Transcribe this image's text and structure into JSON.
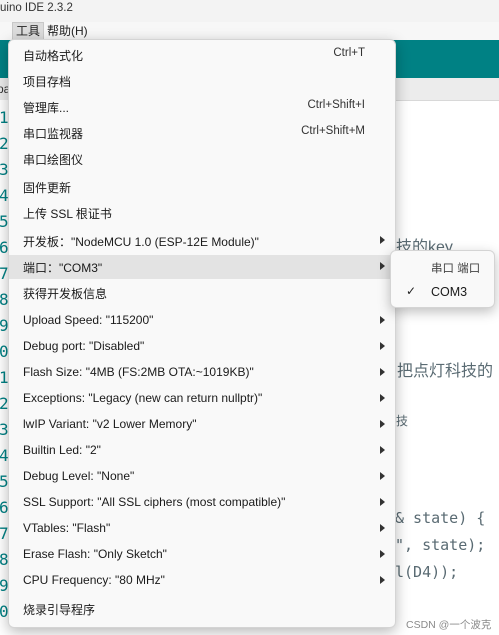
{
  "window": {
    "title": "uino IDE 2.3.2"
  },
  "menubar": {
    "file_fragment": "l",
    "tools": "工具",
    "help": "帮助(H)"
  },
  "editor": {
    "tab_fragment": "pa",
    "line_numbers": [
      "1",
      "2",
      "3",
      "4",
      "5",
      "6",
      "7",
      "8",
      "9",
      "0",
      "1",
      "2",
      "3",
      "4",
      "5",
      "6",
      "7",
      "8",
      "9",
      "0"
    ],
    "code": {
      "key_fragment": "技的key",
      "light_fragment": "把点灯科技的",
      "small_fragment": "技",
      "state_line": "& state) {",
      "state_print": "\", state);",
      "d4_line": "l(D4));"
    }
  },
  "tools_menu": {
    "items": [
      {
        "label": "自动格式化",
        "shortcut": "Ctrl+T"
      },
      {
        "label": "项目存档"
      },
      {
        "label": "管理库...",
        "shortcut": "Ctrl+Shift+I"
      },
      {
        "label": "串口监视器",
        "shortcut": "Ctrl+Shift+M"
      },
      {
        "label": "串口绘图仪"
      },
      {
        "label": "固件更新"
      },
      {
        "label": "上传 SSL 根证书"
      },
      {
        "label": "开发板：\"NodeMCU 1.0 (ESP-12E Module)\"",
        "submenu": true
      },
      {
        "label": "端口：\"COM3\"",
        "submenu": true,
        "highlighted": true
      },
      {
        "label": "获得开发板信息"
      },
      {
        "label": "Upload Speed: \"115200\"",
        "submenu": true
      },
      {
        "label": "Debug port: \"Disabled\"",
        "submenu": true
      },
      {
        "label": "Flash Size: \"4MB (FS:2MB OTA:~1019KB)\"",
        "submenu": true
      },
      {
        "label": "Exceptions: \"Legacy (new can return nullptr)\"",
        "submenu": true
      },
      {
        "label": "lwIP Variant: \"v2 Lower Memory\"",
        "submenu": true
      },
      {
        "label": "Builtin Led: \"2\"",
        "submenu": true
      },
      {
        "label": "Debug Level: \"None\"",
        "submenu": true
      },
      {
        "label": "SSL Support: \"All SSL ciphers (most compatible)\"",
        "submenu": true
      },
      {
        "label": "VTables: \"Flash\"",
        "submenu": true
      },
      {
        "label": "Erase Flash: \"Only Sketch\"",
        "submenu": true
      },
      {
        "label": "CPU Frequency: \"80 MHz\"",
        "submenu": true
      },
      {
        "label": "烧录引导程序"
      }
    ]
  },
  "port_submenu": {
    "header": "串口 端口",
    "selected_port": "COM3",
    "check_icon": "checkmark-icon"
  },
  "watermark": "CSDN @一个波克",
  "colors": {
    "toolbar": "#008184",
    "highlight": "#e3e3e3",
    "line_numbers": "#008184"
  }
}
